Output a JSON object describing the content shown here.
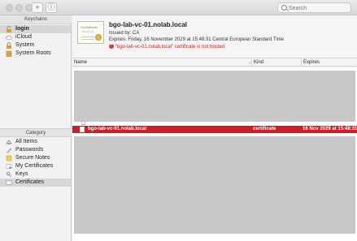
{
  "search": {
    "placeholder": "Search"
  },
  "keychains": {
    "header": "Keychains",
    "items": [
      {
        "label": "login",
        "icon": "lock-open-icon",
        "selected": true
      },
      {
        "label": "iCloud",
        "icon": "cloud-icon",
        "selected": false
      },
      {
        "label": "System",
        "icon": "lock-icon",
        "selected": false
      },
      {
        "label": "System Roots",
        "icon": "cabinet-icon",
        "selected": false
      }
    ]
  },
  "category": {
    "header": "Category",
    "items": [
      {
        "label": "All Items",
        "icon": "all-items-icon",
        "selected": false
      },
      {
        "label": "Passwords",
        "icon": "pen-icon",
        "selected": false
      },
      {
        "label": "Secure Notes",
        "icon": "note-icon",
        "selected": false
      },
      {
        "label": "My Certificates",
        "icon": "my-cert-icon",
        "selected": false
      },
      {
        "label": "Keys",
        "icon": "key-icon",
        "selected": false
      },
      {
        "label": "Certificates",
        "icon": "certificate-icon",
        "selected": true
      }
    ]
  },
  "cert": {
    "thumb_title": "Certificate",
    "thumb_sub": "Standard",
    "title": "bgo-lab-vc-01.nolab.local",
    "issued_by": "Issued by: CA",
    "expires": "Expires: Friday, 16 November 2029 at 15:48:31 Central European Standard Time",
    "warning": "“bgo-lab-vc-01.nolab.local” certificate is not trusted"
  },
  "table": {
    "columns": [
      "Name",
      "Kind",
      "Expires"
    ],
    "rows": [
      {
        "name": "bgo-lab-vc-01.nolab.local",
        "kind": "certificate",
        "expires": "16 Nov 2029 at 15:48:31"
      }
    ]
  },
  "colors": {
    "selected_row": "#cf1d26",
    "warning": "#d02020"
  }
}
